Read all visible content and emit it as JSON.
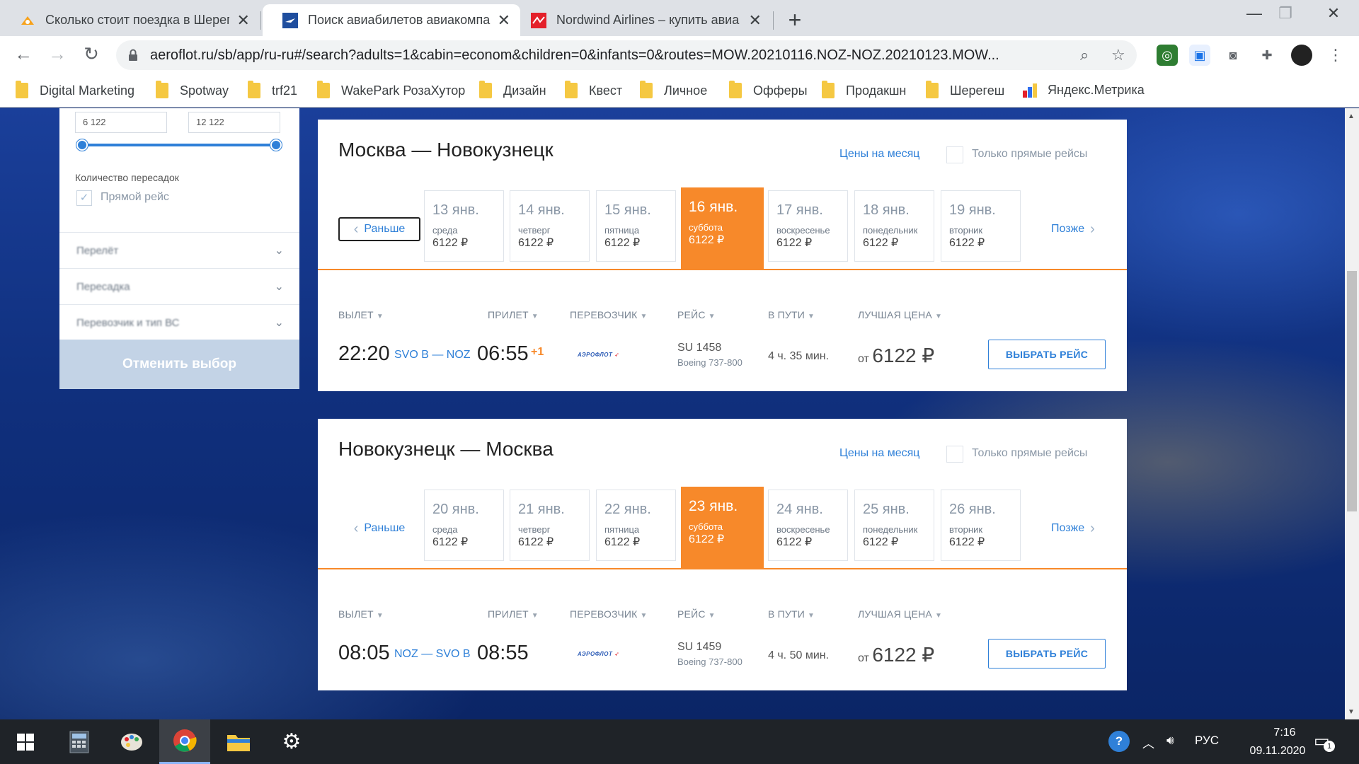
{
  "browser": {
    "tabs": [
      {
        "title": "Сколько стоит поездка в Шерег",
        "icon": "blogger-orange-icon"
      },
      {
        "title": "Поиск авиабилетов авиакомпа",
        "icon": "aeroflot-icon"
      },
      {
        "title": "Nordwind Airlines – купить авиа",
        "icon": "nordwind-icon"
      }
    ],
    "url": "aeroflot.ru/sb/app/ru-ru#/search?adults=1&cabin=econom&children=0&infants=0&routes=MOW.20210116.NOZ-NOZ.20210123.MOW...",
    "bookmarks": [
      "Digital Marketing",
      "Spotway",
      "trf21",
      "WakePark РозаХутор",
      "Дизайн",
      "Квест",
      "Личное",
      "Офферы",
      "Продакшн",
      "Шерегеш",
      "Яндекс.Метрика"
    ]
  },
  "filters": {
    "price_from": "6 122",
    "price_to": "12 122",
    "stops_title": "Количество пересадок",
    "direct_label": "Прямой рейс",
    "accordions": [
      "Перелёт",
      "Пересадка",
      "Перевозчик и тип ВС"
    ],
    "cancel_label": "Отменить выбор"
  },
  "labels": {
    "month_prices": "Цены на месяц",
    "direct_only": "Только прямые рейсы",
    "earlier": "Раньше",
    "later": "Позже",
    "col_dep": "ВЫЛЕТ",
    "col_arr": "ПРИЛЕТ",
    "col_carrier": "ПЕРЕВОЗЧИК",
    "col_flight": "РЕЙС",
    "col_duration": "В ПУТИ",
    "col_price": "ЛУЧШАЯ ЦЕНА",
    "from": "от",
    "select_flight": "ВЫБРАТЬ РЕЙС",
    "carrier_logo": "АЭРОФЛОТ"
  },
  "outbound": {
    "route": "Москва — Новокузнецк",
    "dates": [
      {
        "day": "13 янв.",
        "weekday": "среда",
        "price": "6122 ₽"
      },
      {
        "day": "14 янв.",
        "weekday": "четверг",
        "price": "6122 ₽"
      },
      {
        "day": "15 янв.",
        "weekday": "пятница",
        "price": "6122 ₽"
      },
      {
        "day": "16 янв.",
        "weekday": "суббота",
        "price": "6122 ₽"
      },
      {
        "day": "17 янв.",
        "weekday": "воскресенье",
        "price": "6122 ₽"
      },
      {
        "day": "18 янв.",
        "weekday": "понедельник",
        "price": "6122 ₽"
      },
      {
        "day": "19 янв.",
        "weekday": "вторник",
        "price": "6122 ₽"
      }
    ],
    "flight": {
      "dep_time": "22:20",
      "airports": "SVO B — NOZ",
      "arr_time": "06:55",
      "next_day": "+1",
      "number": "SU 1458",
      "aircraft": "Boeing 737-800",
      "duration": "4 ч. 35 мин.",
      "price": "6122 ₽"
    }
  },
  "inbound": {
    "route": "Новокузнецк — Москва",
    "dates": [
      {
        "day": "20 янв.",
        "weekday": "среда",
        "price": "6122 ₽"
      },
      {
        "day": "21 янв.",
        "weekday": "четверг",
        "price": "6122 ₽"
      },
      {
        "day": "22 янв.",
        "weekday": "пятница",
        "price": "6122 ₽"
      },
      {
        "day": "23 янв.",
        "weekday": "суббота",
        "price": "6122 ₽"
      },
      {
        "day": "24 янв.",
        "weekday": "воскресенье",
        "price": "6122 ₽"
      },
      {
        "day": "25 янв.",
        "weekday": "понедельник",
        "price": "6122 ₽"
      },
      {
        "day": "26 янв.",
        "weekday": "вторник",
        "price": "6122 ₽"
      }
    ],
    "flight": {
      "dep_time": "08:05",
      "airports": "NOZ — SVO B",
      "arr_time": "08:55",
      "number": "SU 1459",
      "aircraft": "Boeing 737-800",
      "duration": "4 ч. 50 мин.",
      "price": "6122 ₽"
    }
  },
  "taskbar": {
    "lang": "РУС",
    "time": "7:16",
    "date": "09.11.2020",
    "notifications": "1"
  },
  "colors": {
    "accent": "#f7892a",
    "link": "#2f80d8"
  }
}
